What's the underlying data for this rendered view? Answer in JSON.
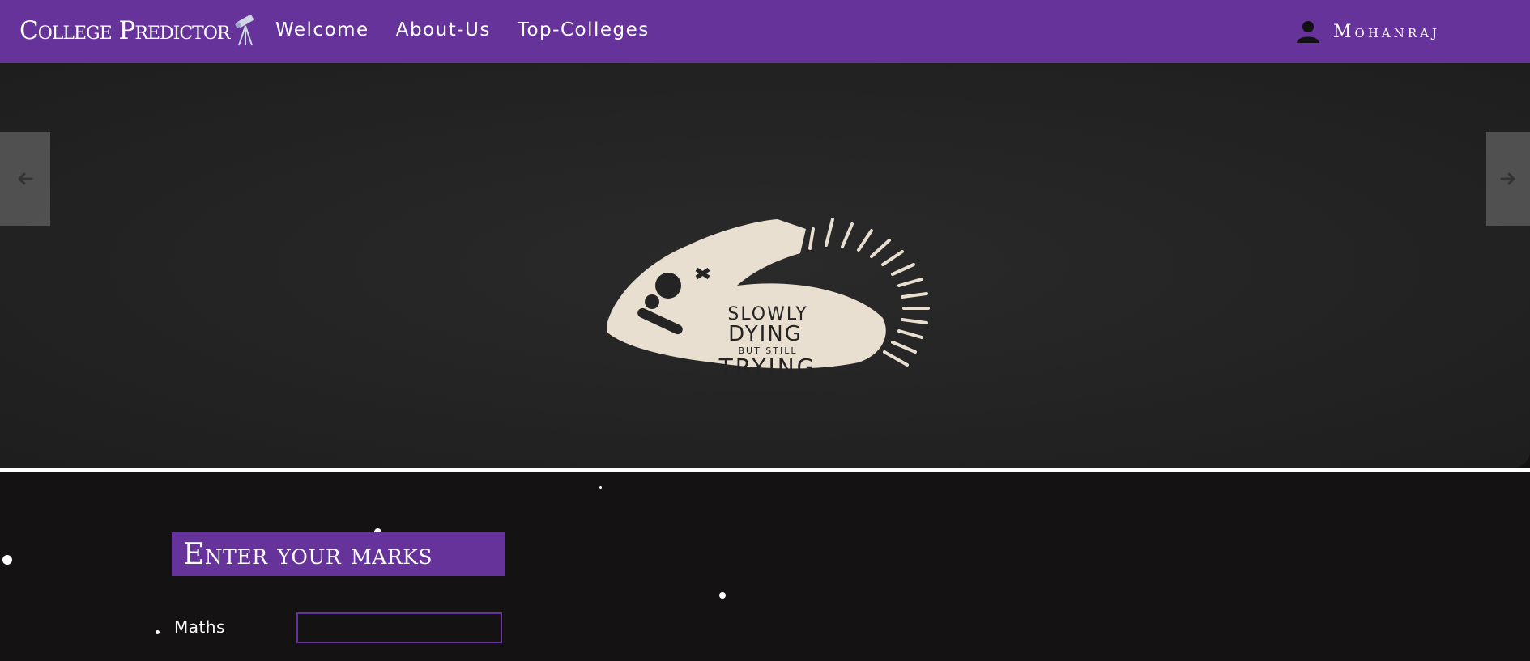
{
  "navbar": {
    "brand": "College Predictor",
    "links": [
      "Welcome",
      "About-Us",
      "Top-Colleges"
    ],
    "user_name": "Mohanraj",
    "background": "#65339a"
  },
  "carousel": {
    "prev_icon": "arrow-left-icon",
    "next_icon": "arrow-right-icon",
    "slide_text": [
      "SLOWLY",
      "DYING",
      "BUT STILL",
      "TRYING"
    ]
  },
  "form": {
    "heading": "Enter your marks",
    "fields": [
      {
        "label": "Maths",
        "value": ""
      }
    ],
    "accent": "#65339a"
  }
}
